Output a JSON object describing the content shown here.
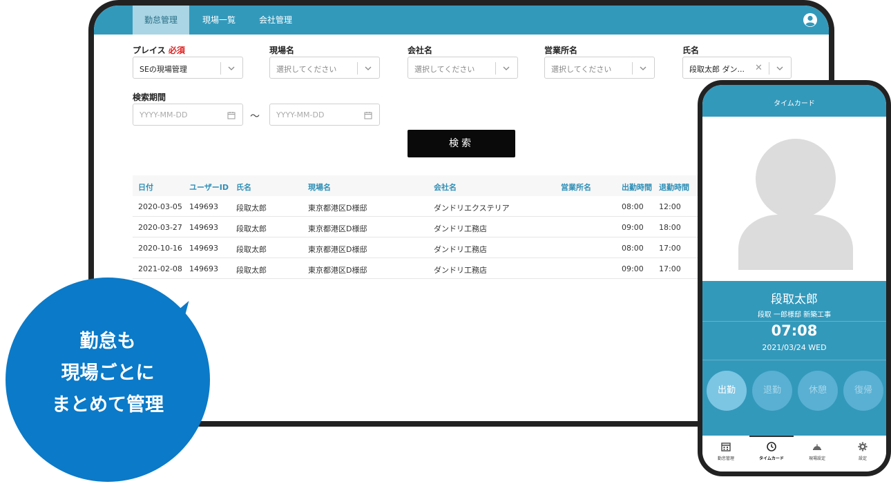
{
  "nav": {
    "tabs": [
      {
        "label": "勤怠管理",
        "active": true
      },
      {
        "label": "現場一覧",
        "active": false
      },
      {
        "label": "会社管理",
        "active": false
      }
    ]
  },
  "filters": {
    "place": {
      "label": "プレイス",
      "required": "必須",
      "value": "SEの現場管理"
    },
    "site": {
      "label": "現場名",
      "placeholder": "選択してください"
    },
    "company": {
      "label": "会社名",
      "placeholder": "選択してください"
    },
    "office": {
      "label": "営業所名",
      "placeholder": "選択してください"
    },
    "name": {
      "label": "氏名",
      "value": "段取太郎 ダン..."
    },
    "period": {
      "label": "検索期間",
      "from_placeholder": "YYYY-MM-DD",
      "to_placeholder": "YYYY-MM-DD",
      "separator": "～"
    },
    "search_label": "検索"
  },
  "table": {
    "headers": [
      "日付",
      "ユーザーID",
      "氏名",
      "現場名",
      "会社名",
      "営業所名",
      "出勤時間",
      "退勤時間"
    ],
    "rows": [
      {
        "date": "2020-03-05",
        "user_id": "149693",
        "name": "段取太郎",
        "site": "東京都港区D様邸",
        "company": "ダンドリエクステリア",
        "office": "",
        "in": "08:00",
        "out": "12:00"
      },
      {
        "date": "2020-03-27",
        "user_id": "149693",
        "name": "段取太郎",
        "site": "東京都港区D様邸",
        "company": "ダンドリ工務店",
        "office": "",
        "in": "09:00",
        "out": "18:00"
      },
      {
        "date": "2020-10-16",
        "user_id": "149693",
        "name": "段取太郎",
        "site": "東京都港区D様邸",
        "company": "ダンドリ工務店",
        "office": "",
        "in": "08:00",
        "out": "17:00"
      },
      {
        "date": "2021-02-08",
        "user_id": "149693",
        "name": "段取太郎",
        "site": "東京都港区D様邸",
        "company": "ダンドリ工務店",
        "office": "",
        "in": "09:00",
        "out": "17:00"
      }
    ]
  },
  "bubble": {
    "line1": "勤怠も",
    "line2": "現場ごとに",
    "line3": "まとめて管理"
  },
  "phone": {
    "header_title": "タイムカード",
    "user_name": "段取太郎",
    "site_line": "段取 一郎様邸 新築工事",
    "time": "07:08",
    "date": "2021/03/24  WED",
    "buttons": [
      {
        "label": "出勤",
        "active": true
      },
      {
        "label": "退勤",
        "active": false
      },
      {
        "label": "休憩",
        "active": false
      },
      {
        "label": "復帰",
        "active": false
      }
    ],
    "tabs": [
      {
        "label": "勤怠管理",
        "icon": "calendar-icon"
      },
      {
        "label": "タイムカード",
        "icon": "clock-icon",
        "active": true
      },
      {
        "label": "現場設定",
        "icon": "helmet-icon"
      },
      {
        "label": "設定",
        "icon": "gear-icon"
      }
    ]
  },
  "colors": {
    "brand": "#3399bb",
    "brand_light": "#a9d5e4",
    "bubble": "#0b7ac8",
    "required": "#e02020"
  }
}
